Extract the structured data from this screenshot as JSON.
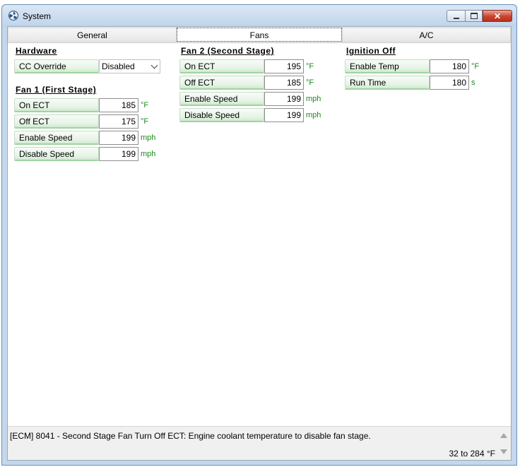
{
  "window": {
    "title": "System",
    "icon": "fan-icon"
  },
  "tabs": [
    {
      "label": "General"
    },
    {
      "label": "Fans"
    },
    {
      "label": "A/C"
    }
  ],
  "active_tab": "Fans",
  "hardware": {
    "title": "Hardware",
    "cc_override": {
      "label": "CC Override",
      "value": "Disabled"
    }
  },
  "fan1": {
    "title": "Fan 1 (First Stage)",
    "rows": [
      {
        "label": "On ECT",
        "value": "185",
        "unit": "°F"
      },
      {
        "label": "Off ECT",
        "value": "175",
        "unit": "°F"
      },
      {
        "label": "Enable Speed",
        "value": "199",
        "unit": "mph"
      },
      {
        "label": "Disable Speed",
        "value": "199",
        "unit": "mph"
      }
    ]
  },
  "fan2": {
    "title": "Fan 2 (Second Stage)",
    "rows": [
      {
        "label": "On ECT",
        "value": "195",
        "unit": "°F"
      },
      {
        "label": "Off ECT",
        "value": "185",
        "unit": "°F"
      },
      {
        "label": "Enable Speed",
        "value": "199",
        "unit": "mph"
      },
      {
        "label": "Disable Speed",
        "value": "199",
        "unit": "mph"
      }
    ]
  },
  "ignition": {
    "title": "Ignition Off",
    "rows": [
      {
        "label": "Enable Temp",
        "value": "180",
        "unit": "°F"
      },
      {
        "label": "Run Time",
        "value": "180",
        "unit": "s"
      }
    ]
  },
  "status": {
    "description": "[ECM] 8041 - Second Stage Fan Turn Off ECT: Engine coolant temperature to disable fan stage.",
    "range": "32 to 284 °F"
  },
  "colors": {
    "unit_text": "#1a8a1a",
    "label_accent": "#9fd49f",
    "close_button": "#c9442e"
  }
}
